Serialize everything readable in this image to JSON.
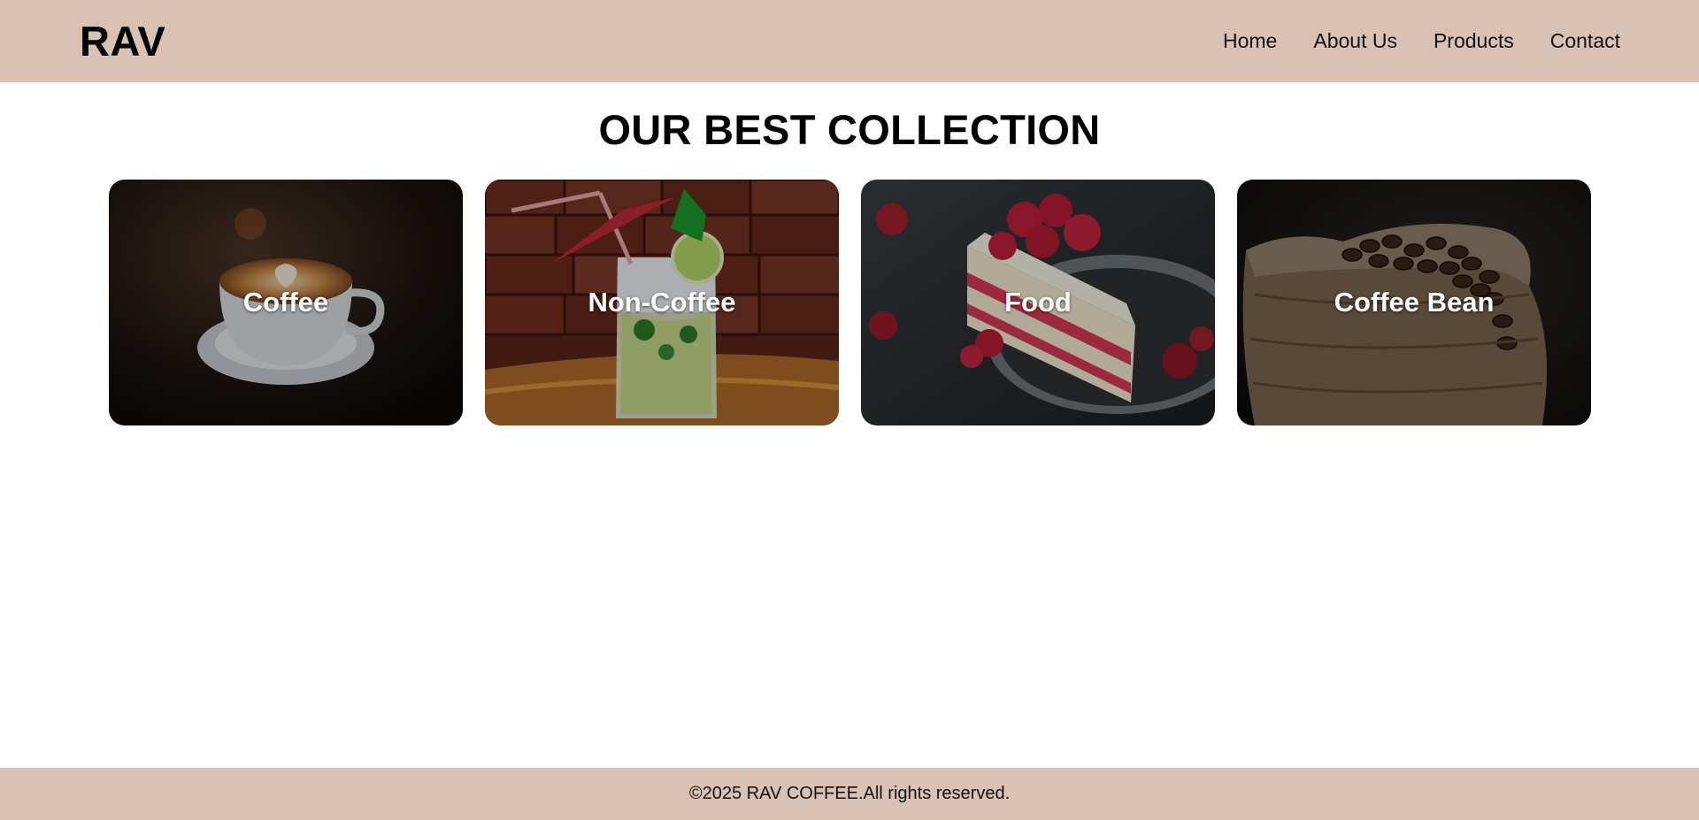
{
  "header": {
    "logo": "RAV",
    "nav": [
      "Home",
      "About Us",
      "Products",
      "Contact"
    ]
  },
  "main": {
    "title": "OUR BEST COLLECTION",
    "collections": [
      {
        "label": "Coffee",
        "image": "latte-art-cup"
      },
      {
        "label": "Non-Coffee",
        "image": "mojito-glass"
      },
      {
        "label": "Food",
        "image": "raspberry-cake-slice"
      },
      {
        "label": "Coffee Bean",
        "image": "coffee-bean-sack"
      }
    ]
  },
  "footer": {
    "text": "©2025 RAV COFFEE.All rights reserved."
  },
  "colors": {
    "header_bg": "#d9c1b4",
    "footer_bg": "#d9c1b4",
    "page_bg": "#ffffff"
  }
}
